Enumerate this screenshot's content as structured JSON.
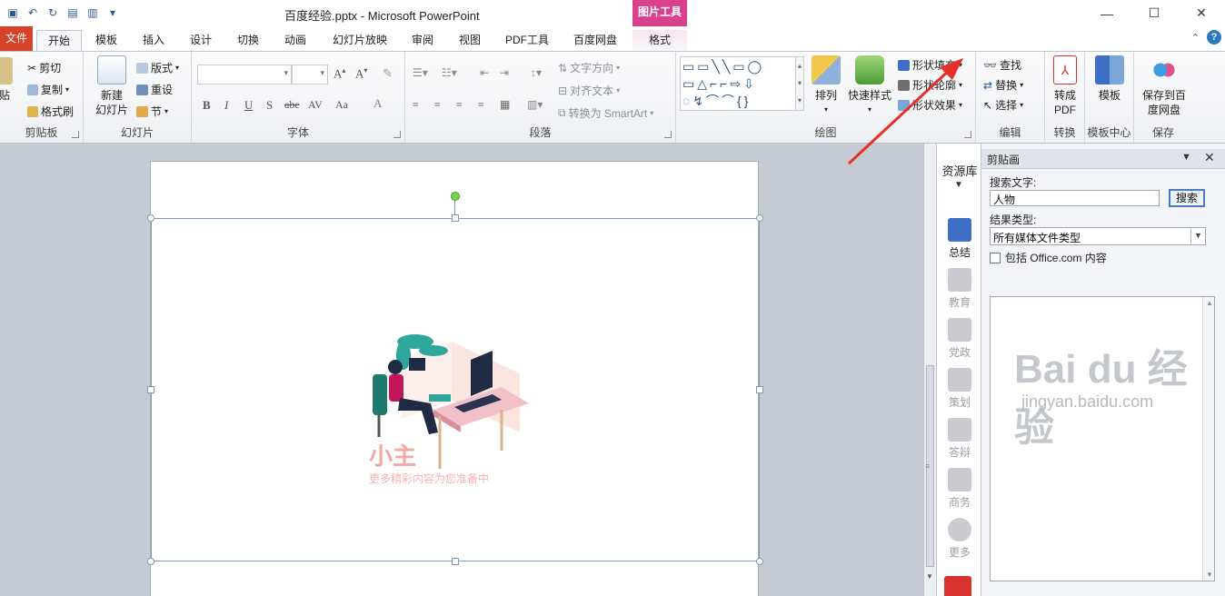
{
  "window": {
    "title": "百度经验.pptx - Microsoft PowerPoint",
    "context_tool": "图片工具",
    "min": "—",
    "max": "☐",
    "close": "✕"
  },
  "tabs": {
    "file": "文件",
    "home": "开始",
    "template": "模板",
    "insert": "插入",
    "design": "设计",
    "transitions": "切换",
    "animations": "动画",
    "slideshow": "幻灯片放映",
    "review": "审阅",
    "view": "视图",
    "pdf": "PDF工具",
    "baidu_disk": "百度网盘",
    "format": "格式"
  },
  "ribbon": {
    "clipboard": {
      "label": "剪贴板",
      "paste": "粘贴",
      "cut": "剪切",
      "copy": "复制",
      "format_painter": "格式刷"
    },
    "slides": {
      "label": "幻灯片",
      "new_slide_line1": "新建",
      "new_slide_line2": "幻灯片",
      "layout": "版式",
      "reset": "重设",
      "section": "节"
    },
    "font": {
      "label": "字体",
      "bold": "B",
      "italic": "I",
      "underline": "U",
      "shadow": "S",
      "strike": "abe",
      "spacing": "AV",
      "case": "Aa",
      "color": "A"
    },
    "paragraph": {
      "label": "段落",
      "text_direction": "文字方向",
      "align_text": "对齐文本",
      "smartart": "转换为 SmartArt"
    },
    "drawing": {
      "label": "绘图",
      "arrange": "排列",
      "quick_styles": "快速样式",
      "shape_fill": "形状填充",
      "shape_outline": "形状轮廓",
      "shape_effects": "形状效果"
    },
    "editing": {
      "label": "编辑",
      "find": "查找",
      "replace": "替换",
      "select": "选择"
    },
    "convert": {
      "label": "转换",
      "to_pdf_line1": "转成",
      "to_pdf_line2": "PDF"
    },
    "template_center": {
      "label": "模板中心",
      "template": "模板"
    },
    "save": {
      "label": "保存",
      "save_baidu_line1": "保存到百",
      "save_baidu_line2": "度网盘"
    }
  },
  "slide": {
    "watermark_title": "小主",
    "watermark_sub": "更多精彩内容为您准备中"
  },
  "resource_library": {
    "title": "资源库",
    "categories": [
      "总结",
      "教育",
      "党政",
      "策划",
      "答辩",
      "商务",
      "更多"
    ]
  },
  "clip_pane": {
    "title": "剪贴画",
    "search_label": "搜索文字:",
    "search_value": "人物",
    "search_button": "搜索",
    "result_type_label": "结果类型:",
    "result_type_value": "所有媒体文件类型",
    "include_office": "包括 Office.com 内容"
  },
  "watermark": {
    "brand": "Bai du 经验",
    "url": "jingyan.baidu.com"
  },
  "colors": {
    "file_tab": "#d5432a",
    "context_tool": "#d9408e",
    "accent_blue": "#2b579a",
    "annotation": "#e53027"
  }
}
